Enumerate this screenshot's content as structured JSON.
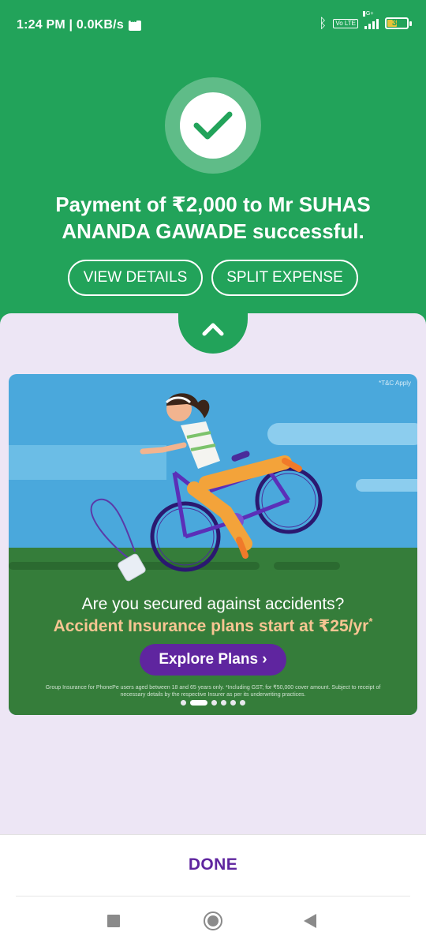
{
  "status_bar": {
    "time_and_speed": "1:24 PM | 0.0KB/s",
    "network_tag": "4G+",
    "volte": "Vo LTE",
    "battery": "37"
  },
  "payment": {
    "message": "Payment of ₹2,000 to Mr SUHAS ANANDA GAWADE successful.",
    "view_details": "VIEW DETAILS",
    "split_expense": "SPLIT EXPENSE"
  },
  "banner": {
    "tc_note": "*T&C Apply",
    "question": "Are you secured against accidents?",
    "offer_prefix": "Accident Insurance plans start at ",
    "offer_price": "₹25/yr",
    "offer_asterisk": "*",
    "cta": "Explore Plans ›",
    "disclaimer": "Group Insurance for PhonePe users aged between 18 and 65 years only. *Including GST; for ₹50,000 cover amount. Subject to receipt of necessary details by the respective Insurer as per its underwriting practices.",
    "carousel_total": 6,
    "carousel_active_index": 1
  },
  "footer": {
    "done": "DONE"
  },
  "colors": {
    "success_green": "#22a35a",
    "sheet_lavender": "#ede6f5",
    "brand_purple": "#5f259f",
    "offer_orange": "#f7c592"
  }
}
